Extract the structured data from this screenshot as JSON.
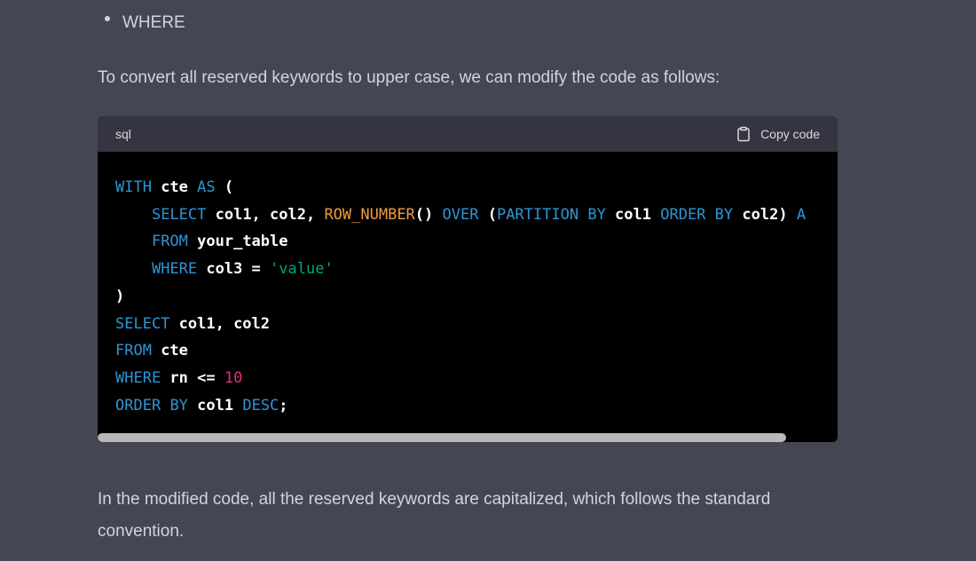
{
  "bullet": {
    "text": "WHERE"
  },
  "intro_text": "To convert all reserved keywords to upper case, we can modify the code as follows:",
  "code_block": {
    "language": "sql",
    "copy_label": "Copy code",
    "icon": "clipboard-icon",
    "scroll_position": 0.0,
    "visible_fraction": 0.93,
    "lines": [
      [
        {
          "t": "WITH",
          "c": "kw"
        },
        {
          "t": " cte ",
          "c": ""
        },
        {
          "t": "AS",
          "c": "kw"
        },
        {
          "t": " (",
          "c": ""
        }
      ],
      [
        {
          "t": "    ",
          "c": ""
        },
        {
          "t": "SELECT",
          "c": "kw"
        },
        {
          "t": " col1, col2, ",
          "c": ""
        },
        {
          "t": "ROW_NUMBER",
          "c": "func"
        },
        {
          "t": "() ",
          "c": ""
        },
        {
          "t": "OVER",
          "c": "kw"
        },
        {
          "t": " (",
          "c": ""
        },
        {
          "t": "PARTITION",
          "c": "kw"
        },
        {
          "t": " ",
          "c": ""
        },
        {
          "t": "BY",
          "c": "kw"
        },
        {
          "t": " col1 ",
          "c": ""
        },
        {
          "t": "ORDER",
          "c": "kw"
        },
        {
          "t": " ",
          "c": ""
        },
        {
          "t": "BY",
          "c": "kw"
        },
        {
          "t": " col2) ",
          "c": ""
        },
        {
          "t": "A",
          "c": "kw"
        }
      ],
      [
        {
          "t": "    ",
          "c": ""
        },
        {
          "t": "FROM",
          "c": "kw"
        },
        {
          "t": " your_table",
          "c": ""
        }
      ],
      [
        {
          "t": "    ",
          "c": ""
        },
        {
          "t": "WHERE",
          "c": "kw"
        },
        {
          "t": " col3 = ",
          "c": ""
        },
        {
          "t": "'value'",
          "c": "str"
        }
      ],
      [
        {
          "t": ")",
          "c": ""
        }
      ],
      [
        {
          "t": "SELECT",
          "c": "kw"
        },
        {
          "t": " col1, col2",
          "c": ""
        }
      ],
      [
        {
          "t": "FROM",
          "c": "kw"
        },
        {
          "t": " cte",
          "c": ""
        }
      ],
      [
        {
          "t": "WHERE",
          "c": "kw"
        },
        {
          "t": " rn <= ",
          "c": ""
        },
        {
          "t": "10",
          "c": "num"
        }
      ],
      [
        {
          "t": "ORDER",
          "c": "kw"
        },
        {
          "t": " ",
          "c": ""
        },
        {
          "t": "BY",
          "c": "kw"
        },
        {
          "t": " col1 ",
          "c": ""
        },
        {
          "t": "DESC",
          "c": "kw"
        },
        {
          "t": ";",
          "c": ""
        }
      ]
    ]
  },
  "outro_text": "In the modified code, all the reserved keywords are capitalized, which follows the standard convention.",
  "colors": {
    "page_background": "#444654",
    "code_background": "#000000",
    "code_header": "#343541",
    "keyword": "#2e95d3",
    "function": "#f19a3e",
    "string": "#00a67d",
    "number": "#df3079"
  }
}
